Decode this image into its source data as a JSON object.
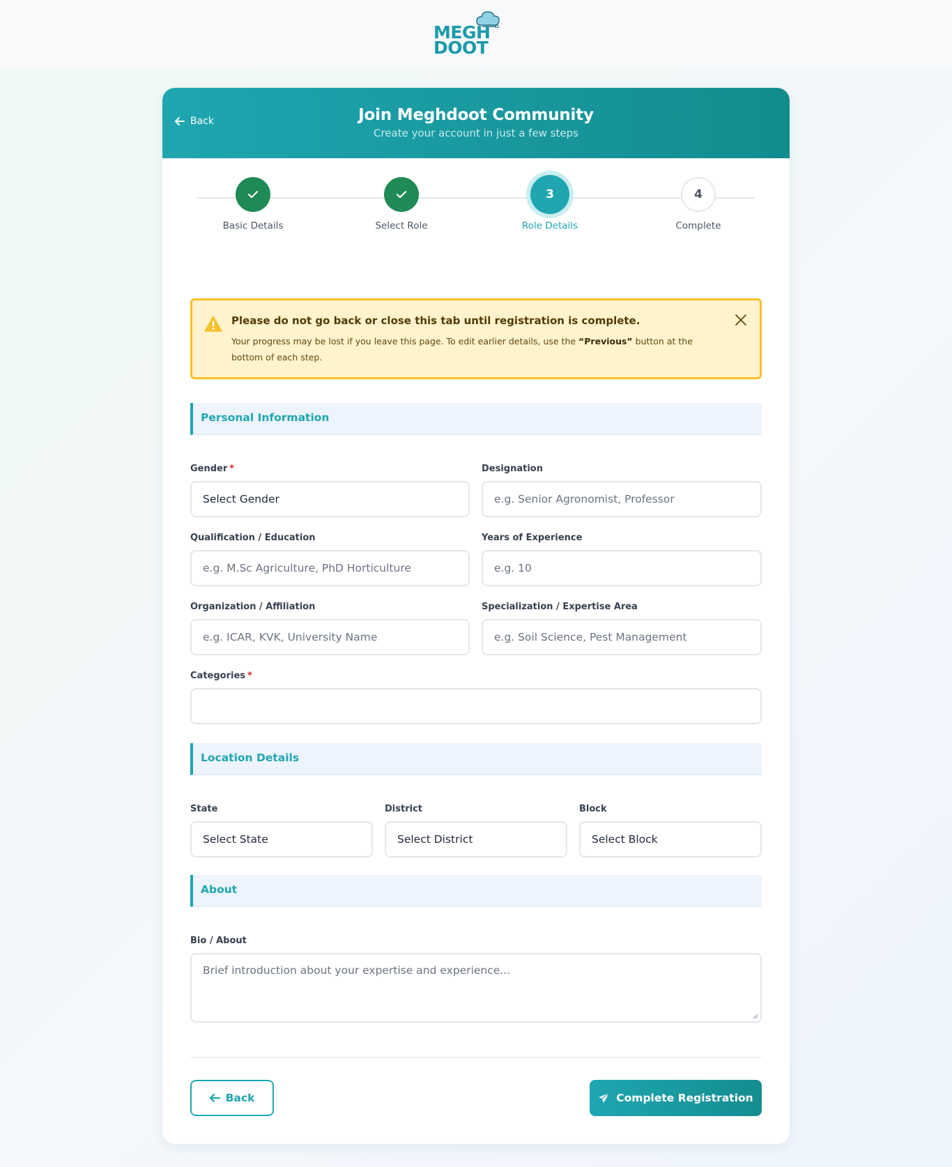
{
  "logo": {
    "line1": "MEGH",
    "line2": "DOOT"
  },
  "header": {
    "back_label": "Back",
    "title": "Join Meghdoot Community",
    "subtitle": "Create your account in just a few steps"
  },
  "stepper": {
    "steps": [
      {
        "label": "Basic Details",
        "state": "done",
        "number": "1"
      },
      {
        "label": "Select Role",
        "state": "done",
        "number": "2"
      },
      {
        "label": "Role Details",
        "state": "active",
        "number": "3"
      },
      {
        "label": "Complete",
        "state": "pending",
        "number": "4"
      }
    ]
  },
  "alert": {
    "title": "Please do not go back or close this tab until registration is complete.",
    "body_before": "Your progress may be lost if you leave this page. To edit earlier details, use the ",
    "body_bold": "“Previous”",
    "body_after": " button at the bottom of each step."
  },
  "sections": {
    "personal": "Personal Information",
    "location": "Location Details",
    "about": "About"
  },
  "fields": {
    "gender": {
      "label": "Gender",
      "required": "*",
      "value": "Select Gender"
    },
    "designation": {
      "label": "Designation",
      "placeholder": "e.g. Senior Agronomist, Professor"
    },
    "qualification": {
      "label": "Qualification / Education",
      "placeholder": "e.g. M.Sc Agriculture, PhD Horticulture"
    },
    "experience": {
      "label": "Years of Experience",
      "placeholder": "e.g. 10"
    },
    "organization": {
      "label": "Organization / Affiliation",
      "placeholder": "e.g. ICAR, KVK, University Name"
    },
    "specialization": {
      "label": "Specialization / Expertise Area",
      "placeholder": "e.g. Soil Science, Pest Management"
    },
    "categories": {
      "label": "Categories",
      "required": "*",
      "value": ""
    },
    "state": {
      "label": "State",
      "value": "Select State"
    },
    "district": {
      "label": "District",
      "value": "Select District"
    },
    "block": {
      "label": "Block",
      "value": "Select Block"
    },
    "bio": {
      "label": "Bio / About",
      "placeholder": "Brief introduction about your expertise and experience..."
    }
  },
  "actions": {
    "back_label": "Back",
    "complete_label": "Complete Registration"
  },
  "colors": {
    "accent": "#1fa6b1",
    "success": "#1f8a55",
    "warning_bg": "#fff3cd",
    "warning_border": "#f6c12c"
  },
  "icons": {
    "header_back": "arrow-left-icon",
    "step_done": "check-icon",
    "alert": "warning-triangle-icon",
    "alert_close": "close-icon",
    "back_button": "arrow-left-icon",
    "complete_button": "paper-plane-icon"
  }
}
